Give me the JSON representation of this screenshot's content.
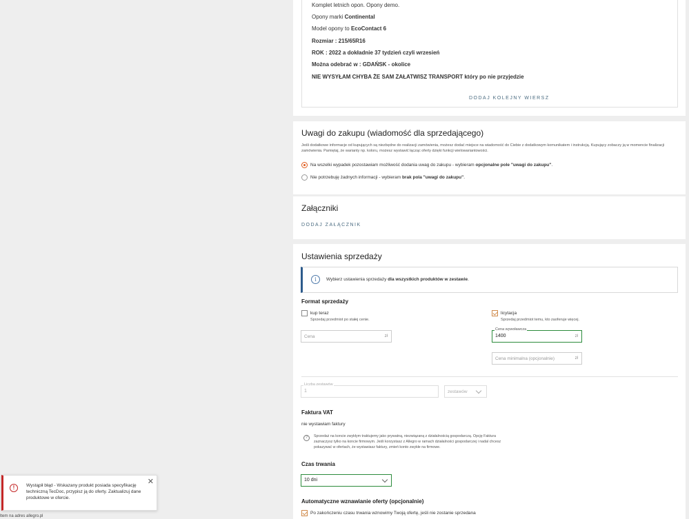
{
  "description": {
    "line1": "Komplet letnich opon. Opony demo.",
    "line2_prefix": "Opony marki ",
    "line2_bold": "Continental",
    "line3_prefix": "Model opony to ",
    "line3_bold": "EcoContact 6",
    "line4": "Rozmiar : 215/65R16",
    "line5": "ROK : 2022 a dokładnie 37 tydzień czyli wrzesień",
    "line6": "Można odebrać w : GDAŃSK - okolice",
    "line7": "NIE WYSYŁAM CHYBA ŻE SAM ZAŁATWISZ TRANSPORT który po nie przyjedzie",
    "add_row": "DODAJ KOLEJNY WIERSZ"
  },
  "notes": {
    "title": "Uwagi do zakupu (wiadomość dla sprzedającego)",
    "help": "Jeśli dodatkowe informacje od kupujących są niezbędne do realizacji zamówienia, możesz dodać miejsce na wiadomość do Ciebie z dodatkowym komunikatem i instrukcją. Kupujący zobaczy ją w momencie finalizacji zamówienia. Pamiętaj, że warianty np. koloru, możesz wystawić łącząc oferty dzięki funkcji wielowariantowości.",
    "opt1_prefix": "Na wszelki wypadek pozostawiam możliwość dodania uwag do zakupu - wybieram ",
    "opt1_bold": "opcjonalne pole \"uwagi do zakupu\"",
    "opt1_suffix": ".",
    "opt2_prefix": "Nie potrzebuję żadnych informacji - wybieram ",
    "opt2_bold": "brak pola \"uwagi do zakupu\"",
    "opt2_suffix": "."
  },
  "attachments": {
    "title": "Załączniki",
    "add": "DODAJ ZAŁĄCZNIK"
  },
  "sales": {
    "title": "Ustawienia sprzedaży",
    "info_prefix": "Wybierz ustawienia sprzedaży ",
    "info_bold": "dla wszystkich produktów w zestawie",
    "info_suffix": ".",
    "format_title": "Format sprzedaży",
    "buy_now": "kup teraz",
    "buy_now_desc": "Sprzedaj przedmiot po stałej cenie.",
    "auction": "licytacja",
    "auction_desc": "Sprzedaj przedmiot temu, kto zaoferuje więcej.",
    "price_placeholder": "Cena",
    "currency": "zł",
    "start_price_label": "Cena wywoławcza",
    "start_price_value": "1400",
    "min_price_placeholder": "Cena minimalna (opcjonalnie)",
    "sets_label": "Liczba zestawów",
    "sets_value": "1",
    "sets_unit": "zestawów",
    "vat_title": "Faktura VAT",
    "vat_value": "nie wystawiam faktury",
    "vat_help": "Sprzedaż na koncie zwykłym traktujemy jako prywatną, niezwiązaną z działalnością gospodarczą. Opcję Faktura zaznaczysz tylko na koncie firmowym. Jeśli korzystasz z Allegro w ramach działalności gospodarczej i nadal chcesz pokazywać w ofertach, że wystawiasz faktury, zmień konto zwykłe na firmowe.",
    "duration_title": "Czas trwania",
    "duration_value": "10 dni",
    "renew_title": "Automatyczne wznawianie oferty (opcjonalnie)",
    "renew_option": "Po zakończeniu czasu trwania wznowimy Twoją ofertę, jeśli nie zostanie sprzedana"
  },
  "toast": {
    "text": "Wystąpił błąd - Wskazany produkt posiada specyfikację techniczną TecDoc, przypisz ją do oferty. Zaktualizuj dane produktowe w ofercie.",
    "close": "✕"
  },
  "statusbar": "ltem na adres allegro.pl"
}
